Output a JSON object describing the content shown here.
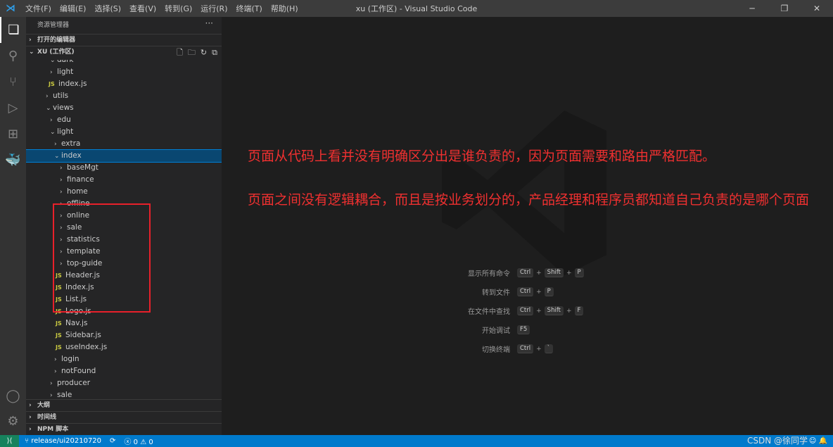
{
  "titlebar": {
    "menus": [
      "文件(F)",
      "编辑(E)",
      "选择(S)",
      "查看(V)",
      "转到(G)",
      "运行(R)",
      "终端(T)",
      "帮助(H)"
    ],
    "title": "xu (工作区) - Visual Studio Code"
  },
  "activity": [
    "files-icon",
    "search-icon",
    "source-control-icon",
    "run-debug-icon",
    "extensions-icon",
    "docker-icon"
  ],
  "sidebar": {
    "header": "资源管理器",
    "open_editors": "打开的编辑器",
    "workspace": "XU (工作区)",
    "tree": [
      {
        "label": "dark",
        "depth": 3,
        "type": "folder",
        "open": true
      },
      {
        "label": "light",
        "depth": 3,
        "type": "folder"
      },
      {
        "label": "index.js",
        "depth": 3,
        "type": "js"
      },
      {
        "label": "utils",
        "depth": 2,
        "type": "folder"
      },
      {
        "label": "views",
        "depth": 2,
        "type": "folder",
        "open": true
      },
      {
        "label": "edu",
        "depth": 3,
        "type": "folder"
      },
      {
        "label": "light",
        "depth": 3,
        "type": "folder",
        "open": true
      },
      {
        "label": "extra",
        "depth": 4,
        "type": "folder"
      },
      {
        "label": "index",
        "depth": 4,
        "type": "folder",
        "open": true,
        "selected": true
      },
      {
        "label": "baseMgt",
        "depth": 5,
        "type": "folder"
      },
      {
        "label": "finance",
        "depth": 5,
        "type": "folder"
      },
      {
        "label": "home",
        "depth": 5,
        "type": "folder"
      },
      {
        "label": "offline",
        "depth": 5,
        "type": "folder"
      },
      {
        "label": "online",
        "depth": 5,
        "type": "folder"
      },
      {
        "label": "sale",
        "depth": 5,
        "type": "folder"
      },
      {
        "label": "statistics",
        "depth": 5,
        "type": "folder"
      },
      {
        "label": "template",
        "depth": 5,
        "type": "folder"
      },
      {
        "label": "top-guide",
        "depth": 5,
        "type": "folder"
      },
      {
        "label": "Header.js",
        "depth": 5,
        "type": "js"
      },
      {
        "label": "Index.js",
        "depth": 5,
        "type": "js"
      },
      {
        "label": "List.js",
        "depth": 5,
        "type": "js"
      },
      {
        "label": "Logo.js",
        "depth": 5,
        "type": "js"
      },
      {
        "label": "Nav.js",
        "depth": 5,
        "type": "js"
      },
      {
        "label": "Sidebar.js",
        "depth": 5,
        "type": "js"
      },
      {
        "label": "useIndex.js",
        "depth": 5,
        "type": "js"
      },
      {
        "label": "login",
        "depth": 4,
        "type": "folder"
      },
      {
        "label": "notFound",
        "depth": 4,
        "type": "folder"
      },
      {
        "label": "producer",
        "depth": 3,
        "type": "folder"
      },
      {
        "label": "sale",
        "depth": 3,
        "type": "folder"
      }
    ],
    "outline": "大纲",
    "timeline": "时间线",
    "npm": "NPM 脚本"
  },
  "editor": {
    "notes": [
      "页面从代码上看并没有明确区分出是谁负责的，因为页面需要和路由严格匹配。",
      "页面之间没有逻辑耦合，而且是按业务划分的，产品经理和程序员都知道自己负责的是哪个页面"
    ],
    "shortcuts": [
      {
        "label": "显示所有命令",
        "keys": [
          "Ctrl",
          "Shift",
          "P"
        ]
      },
      {
        "label": "转到文件",
        "keys": [
          "Ctrl",
          "P"
        ]
      },
      {
        "label": "在文件中查找",
        "keys": [
          "Ctrl",
          "Shift",
          "F"
        ]
      },
      {
        "label": "开始调试",
        "keys": [
          "F5"
        ]
      },
      {
        "label": "切换终端",
        "keys": [
          "Ctrl",
          "`"
        ]
      }
    ]
  },
  "status": {
    "branch": "release/ui20210720",
    "errors": "0",
    "warnings": "0",
    "watermark": "CSDN @徐同学"
  },
  "colors": {
    "accent": "#007acc",
    "annotation": "#f03030",
    "highlight_box": "#e8202a"
  }
}
